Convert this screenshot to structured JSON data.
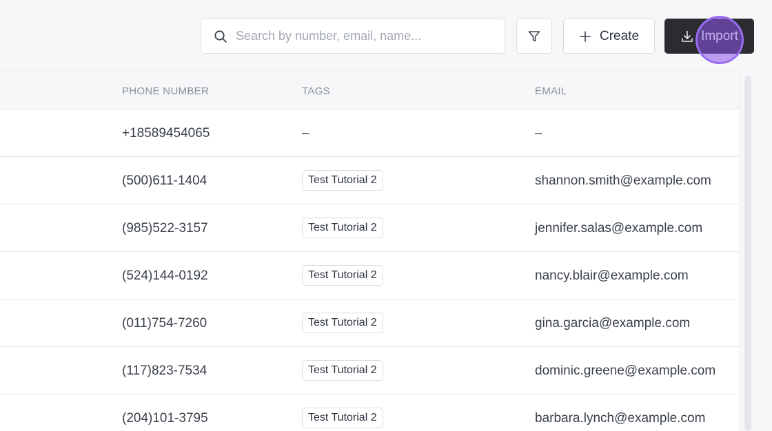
{
  "toolbar": {
    "search_placeholder": "Search by number, email, name...",
    "search_value": "",
    "create_label": "Create",
    "import_label": "Import"
  },
  "table": {
    "columns": [
      "PHONE NUMBER",
      "TAGS",
      "EMAIL"
    ],
    "rows": [
      {
        "phone": "+18589454065",
        "tag": "–",
        "email": "–"
      },
      {
        "phone": "(500)611-1404",
        "tag": "Test Tutorial 2",
        "email": "shannon.smith@example.com"
      },
      {
        "phone": "(985)522-3157",
        "tag": "Test Tutorial 2",
        "email": "jennifer.salas@example.com"
      },
      {
        "phone": "(524)144-0192",
        "tag": "Test Tutorial 2",
        "email": "nancy.blair@example.com"
      },
      {
        "phone": "(011)754-7260",
        "tag": "Test Tutorial 2",
        "email": "gina.garcia@example.com"
      },
      {
        "phone": "(117)823-7534",
        "tag": "Test Tutorial 2",
        "email": "dominic.greene@example.com"
      },
      {
        "phone": "(204)101-3795",
        "tag": "Test Tutorial 2",
        "email": "barbara.lynch@example.com"
      }
    ]
  },
  "icons": {
    "search": "search-icon",
    "filter": "filter-icon",
    "create": "plus-icon",
    "import": "download-icon"
  },
  "colors": {
    "import_bg": "#2a2c30",
    "click_highlight": "#9b6cf1"
  }
}
